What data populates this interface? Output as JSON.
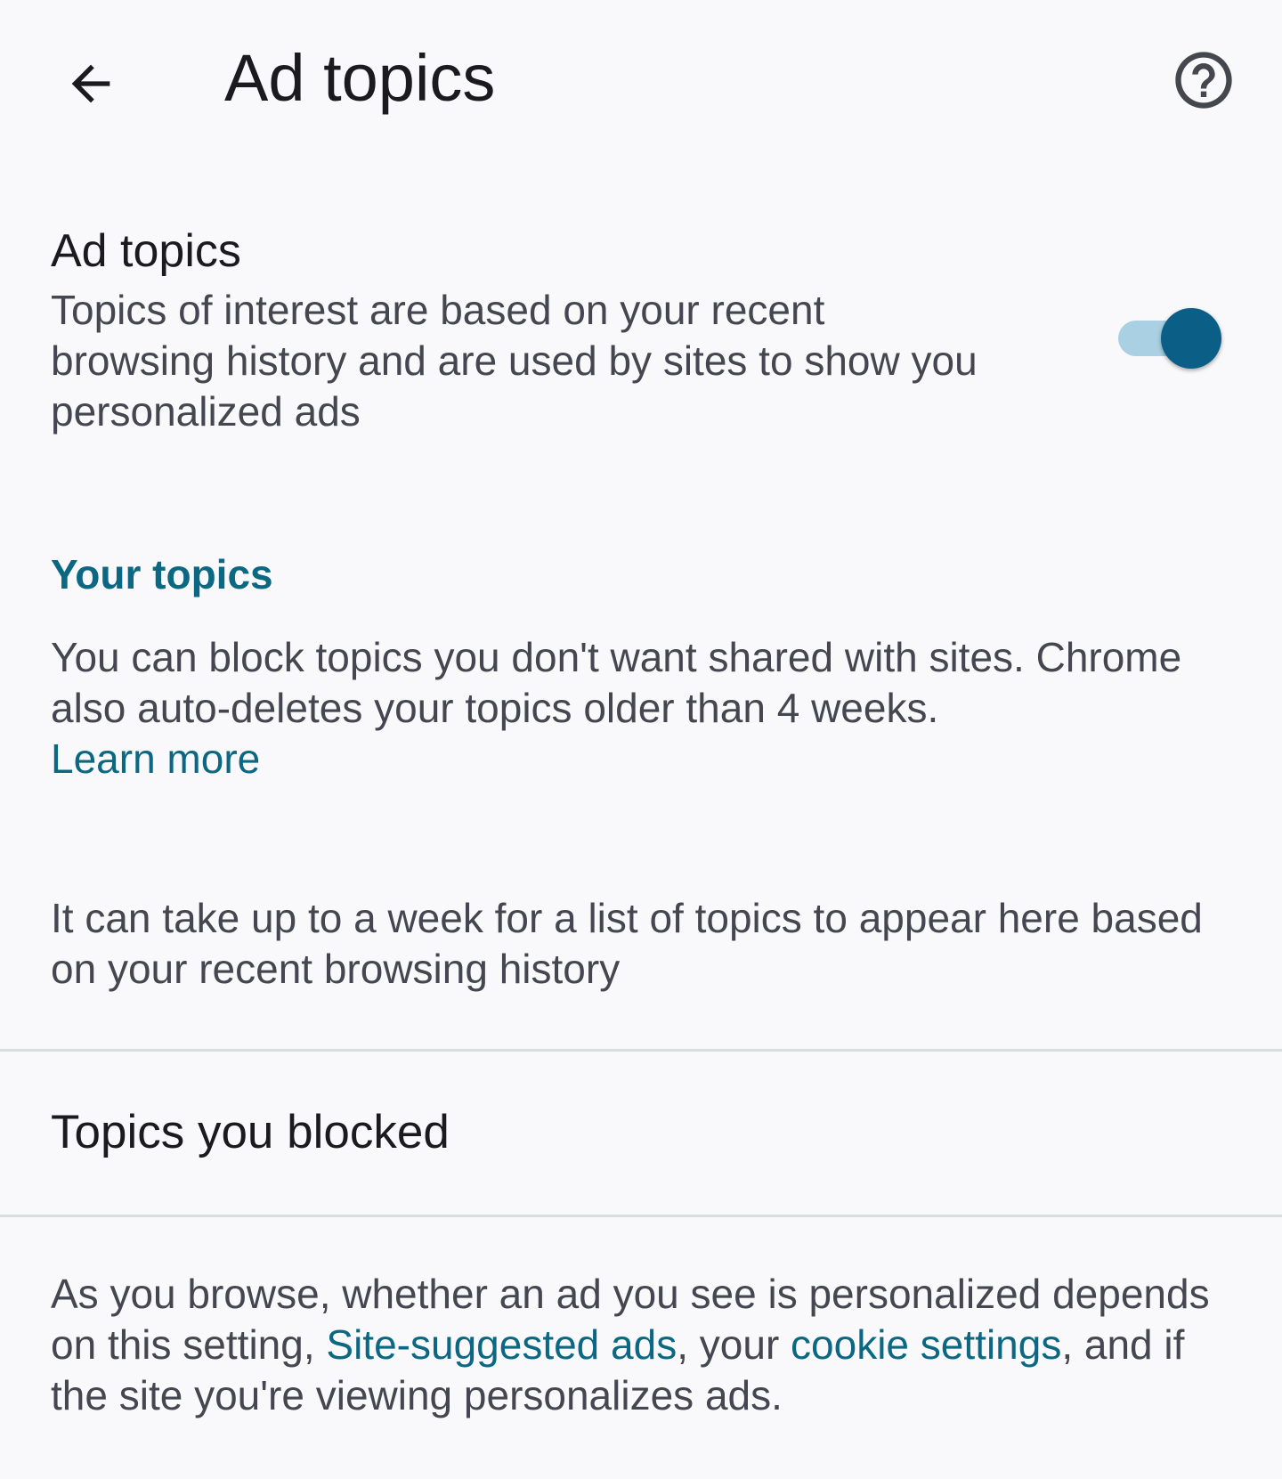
{
  "app_bar": {
    "title": "Ad topics",
    "back_icon": "arrow-back-icon",
    "help_icon": "help-circle-icon"
  },
  "ad_topics_setting": {
    "title": "Ad topics",
    "description": "Topics of interest are based on your recent browsing history and are used by sites to show you personalized ads",
    "toggle_on": true
  },
  "your_topics": {
    "header": "Your topics",
    "info": "You can block topics you don't want shared with sites. Chrome also auto-deletes your topics older than 4 weeks.",
    "learn_more": "Learn more",
    "empty_state": "It can take up to a week for a list of topics to appear here based on your recent browsing history"
  },
  "blocked": {
    "label": "Topics you blocked"
  },
  "footer": {
    "part1": "As you browse, whether an ad you see is personalized depends on this setting, ",
    "link1": "Site-suggested ads",
    "part2": ", your ",
    "link2": "cookie settings",
    "part3": ", and if the site you're viewing personalizes ads."
  },
  "colors": {
    "accent": "#0b6782",
    "toggle_thumb": "#0b5f86",
    "toggle_track": "#a9d1e3",
    "background": "#f9f9fc"
  }
}
